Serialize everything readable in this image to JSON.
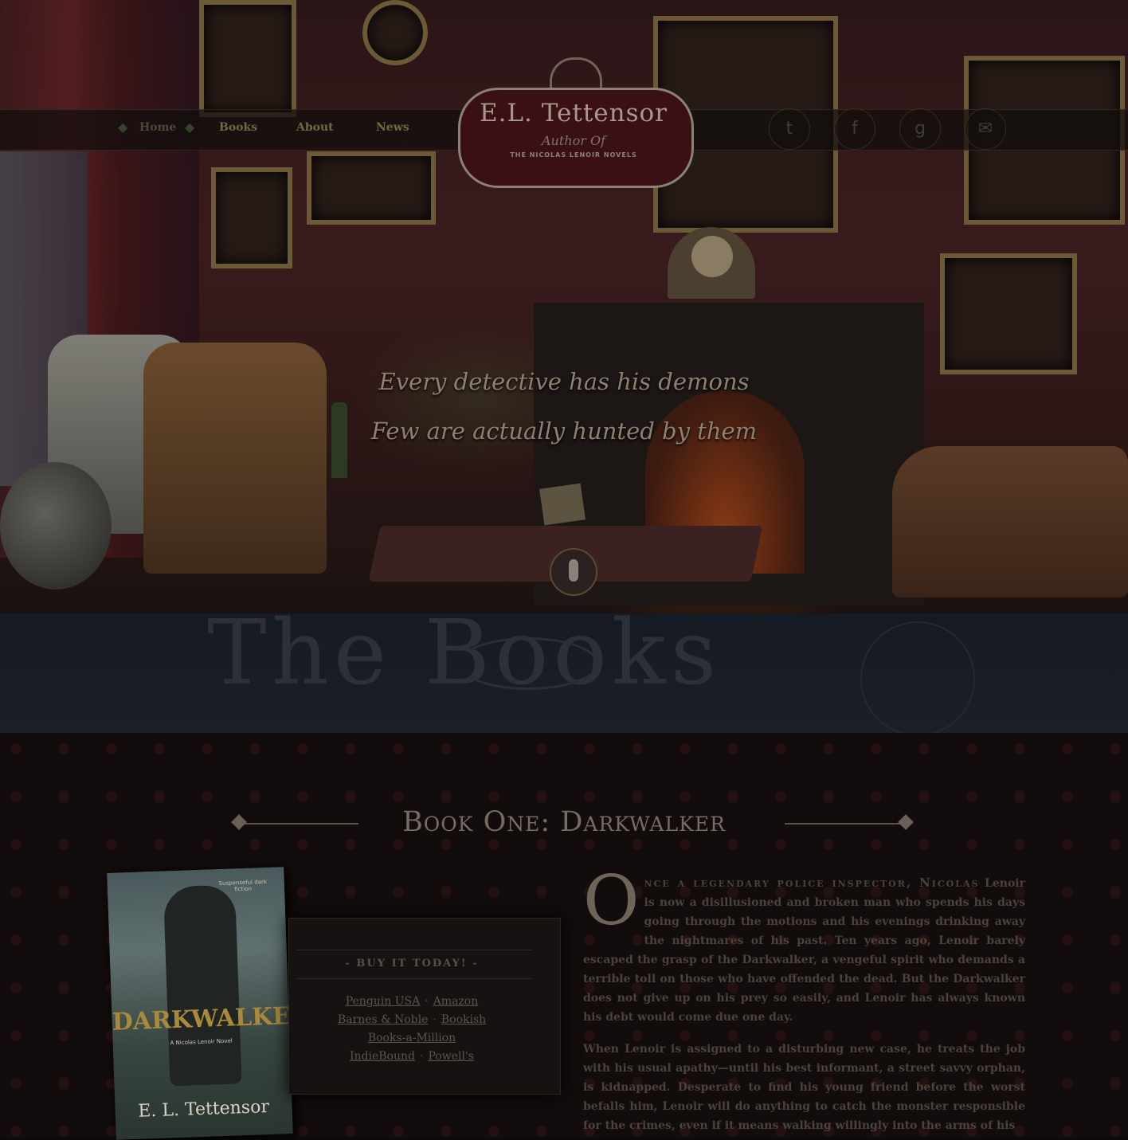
{
  "nav": {
    "items": [
      "Home",
      "Books",
      "About",
      "News"
    ]
  },
  "logo": {
    "name": "E.L. Tettensor",
    "subtitle": "Author Of",
    "series": "THE NICOLAS LENOIR NOVELS"
  },
  "social": [
    {
      "icon": "twitter-icon",
      "glyph": "t"
    },
    {
      "icon": "facebook-icon",
      "glyph": "f"
    },
    {
      "icon": "goodreads-icon",
      "glyph": "g"
    },
    {
      "icon": "email-icon",
      "glyph": "✉"
    }
  ],
  "hero": {
    "tagline_1": "Every detective has his demons",
    "tagline_2": "Few are actually hunted by them"
  },
  "books_banner": {
    "word": "The Books"
  },
  "book": {
    "title": "Book One: Darkwalker",
    "cover": {
      "blurb": "Suspenseful dark fiction",
      "title": "DARKWALKER",
      "series": "A Nicolas Lenoir Novel",
      "author": "E. L. Tettensor"
    },
    "buy_heading": "- BUY IT TODAY! -",
    "retailers": [
      "Penguin USA",
      "Amazon",
      "Barnes & Noble",
      "Bookish",
      "Books-a-Million",
      "IndieBound",
      "Powell's"
    ],
    "dropcap": "O",
    "lead": "nce a legendary police inspector, Nicolas",
    "para1_rest": " Lenoir is now a disillusioned and broken man who spends his days going through the motions and his evenings drinking away the nightmares of his past. Ten years ago, Lenoir barely escaped the grasp of the Darkwalker, a vengeful spirit who demands a terrible toll on those who have offended the dead. But the Darkwalker does not give up on his prey so easily, and Lenoir has always known his debt would come due one day.",
    "para2": "When Lenoir is assigned to a disturbing new case, he treats the job with his usual apathy—until his best informant, a street savvy orphan, is kidnapped. Desperate to find his young friend before the worst befalls him, Lenoir will do anything to catch the monster responsible for the crimes, even if it means walking willingly into the arms of his"
  },
  "colors": {
    "accent": "#776c62",
    "nav_text": "#6d6a40",
    "banner": "#1b1f28"
  }
}
